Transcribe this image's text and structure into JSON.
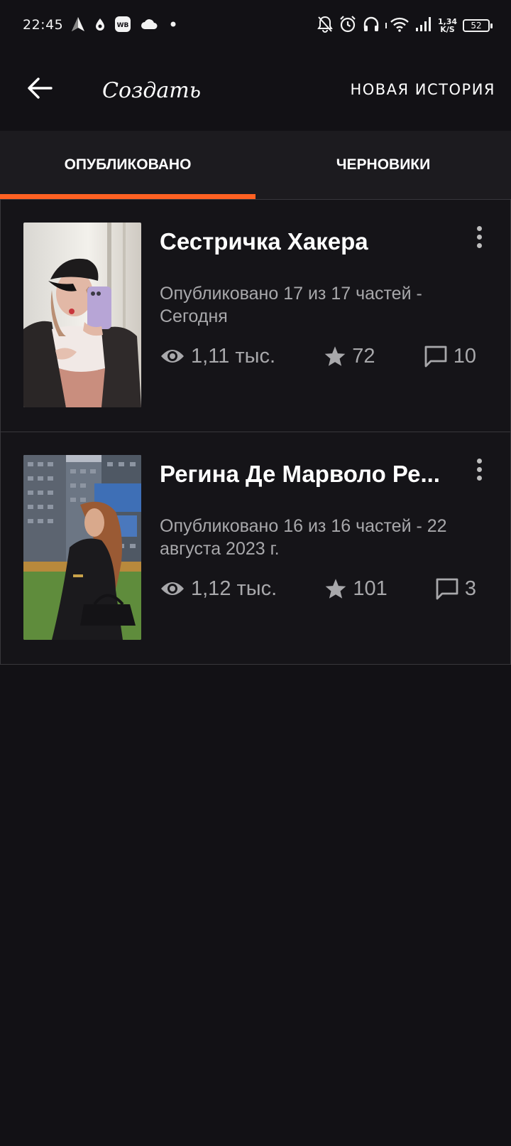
{
  "status_bar": {
    "time": "22:45",
    "speed_value": "1,34",
    "speed_unit": "K/S",
    "battery": "52",
    "left_icons": [
      "navigation-icon",
      "drop-icon",
      "wb-app-icon",
      "cloud-icon",
      "dot-icon"
    ],
    "right_icons": [
      "notifications-off-icon",
      "alarm-icon",
      "headphones-icon",
      "wifi-icon",
      "signal-icon"
    ]
  },
  "app_bar": {
    "back_icon": "arrow-left-icon",
    "title": "Создать",
    "new_story_label": "НОВАЯ ИСТОРИЯ"
  },
  "tabs": [
    {
      "label": "ОПУБЛИКОВАНО",
      "selected": true
    },
    {
      "label": "ЧЕРНОВИКИ",
      "selected": false
    }
  ],
  "colors": {
    "accent": "#ff6122",
    "background": "#121115",
    "tab_bar": "#1c1b1f",
    "muted_text": "#a8a8ab"
  },
  "stories": [
    {
      "title": "Сестричка Хакера",
      "meta": "Опубликовано 17 из 17 частей - Сегодня",
      "views": "1,11 тыс.",
      "votes": "72",
      "comments": "10"
    },
    {
      "title": "Регина Де Марволо Ре...",
      "meta": "Опубликовано 16 из 16 частей - 22 августа 2023 г.",
      "views": "1,12 тыс.",
      "votes": "101",
      "comments": "3"
    }
  ]
}
